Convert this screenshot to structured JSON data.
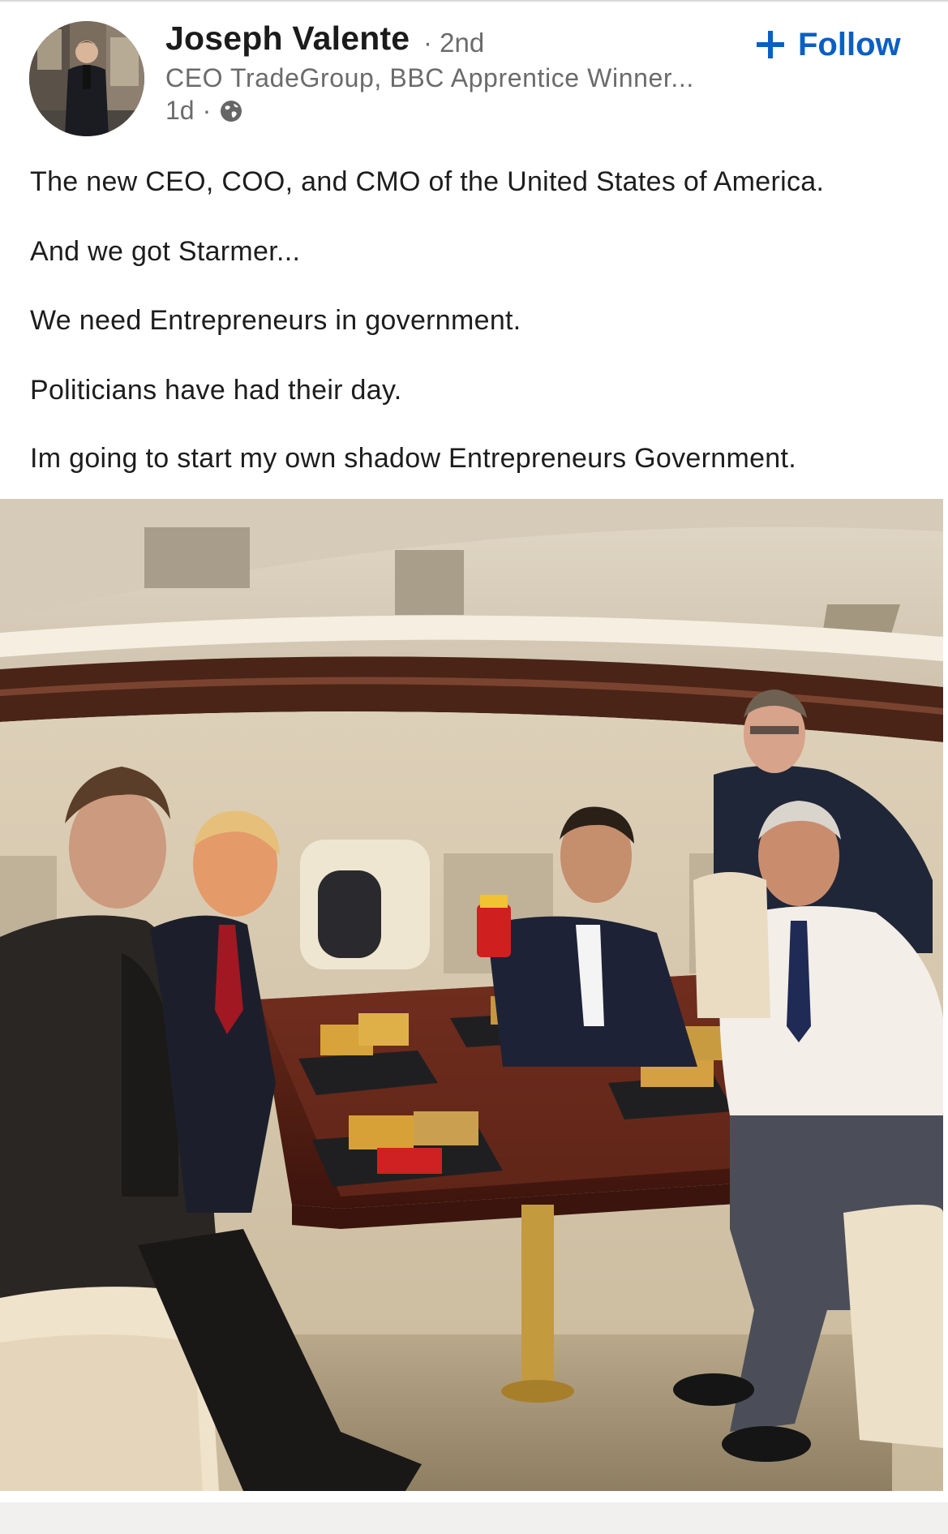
{
  "post": {
    "author": {
      "name": "Joseph Valente",
      "degree": "· 2nd",
      "headline": "CEO TradeGroup, BBC Apprentice Winner...",
      "time": "1d",
      "separator": "·",
      "visibility_icon": "globe-icon",
      "avatar": "profile-photo"
    },
    "follow": {
      "label": "Follow",
      "icon": "plus-icon",
      "color": "#0a5fc4"
    },
    "text_lines": [
      "The new CEO, COO, and CMO of the United States of America.",
      "And we got Starmer...",
      "We need Entrepreneurs in government.",
      "Politicians have had their day.",
      "Im going to start my own shadow Entrepreneurs Government."
    ],
    "photo": {
      "subject": "post-image"
    }
  }
}
